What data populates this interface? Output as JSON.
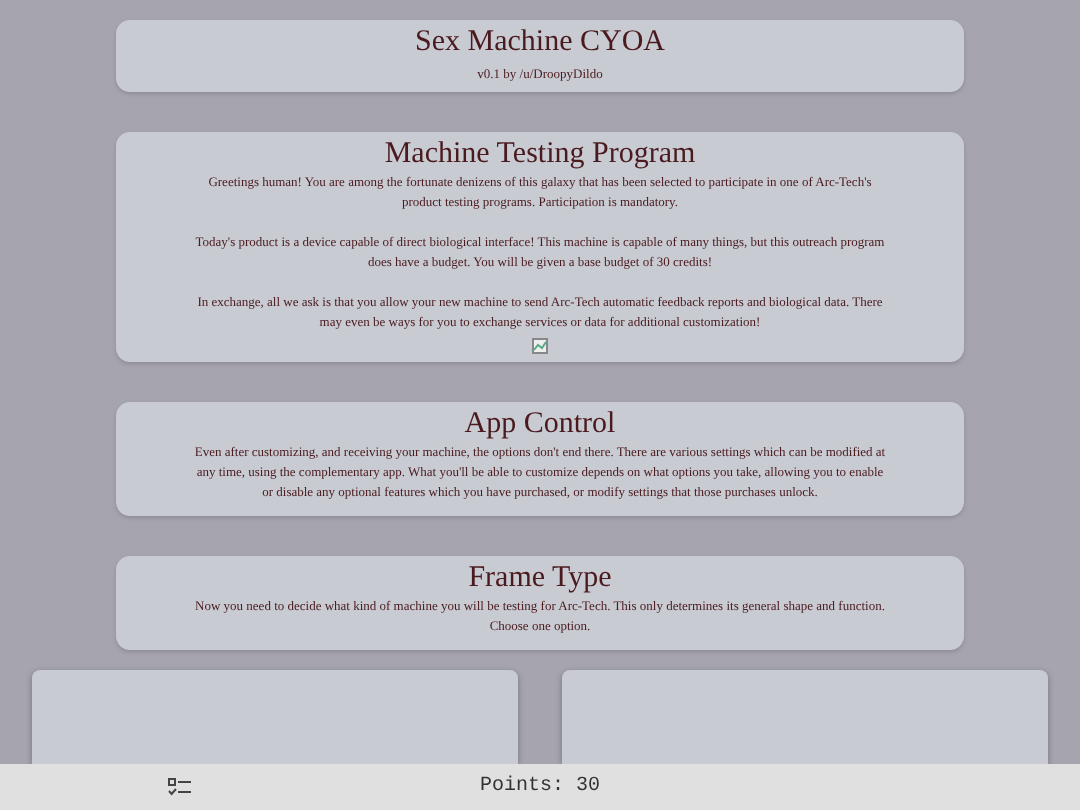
{
  "header": {
    "title": "Sex Machine CYOA",
    "subtitle": "v0.1 by /u/DroopyDildo"
  },
  "sections": [
    {
      "title": "Machine Testing Program",
      "paragraphs": [
        "Greetings human! You are among the fortunate denizens of this galaxy that has been selected to participate in one of Arc-Tech's product testing programs. Participation is mandatory.",
        "Today's product is a device capable of direct biological interface! This machine is capable of many things, but this outreach program does have a budget. You will be given a base budget of 30 credits!",
        "In exchange, all we ask is that you allow your new machine to send Arc-Tech automatic feedback reports and biological data. There may even be ways for you to exchange services or data for additional customization!"
      ],
      "broken_image": true
    },
    {
      "title": "App Control",
      "paragraphs": [
        "Even after customizing, and receiving your machine, the options don't end there. There are various settings which can be modified at any time, using the complementary app. What you'll be able to customize depends on what options you take, allowing you to enable or disable any optional features which you have purchased, or modify settings that those purchases unlock."
      ],
      "broken_image": false
    },
    {
      "title": "Frame Type",
      "paragraphs": [
        "Now you need to decide what kind of machine you will be testing for Arc-Tech. This only determines its general shape and function.\nChoose one option."
      ],
      "broken_image": false
    }
  ],
  "choices": [
    {
      "kind": "card"
    },
    {
      "kind": "card"
    }
  ],
  "bottom_bar": {
    "points": "Points: 30"
  }
}
